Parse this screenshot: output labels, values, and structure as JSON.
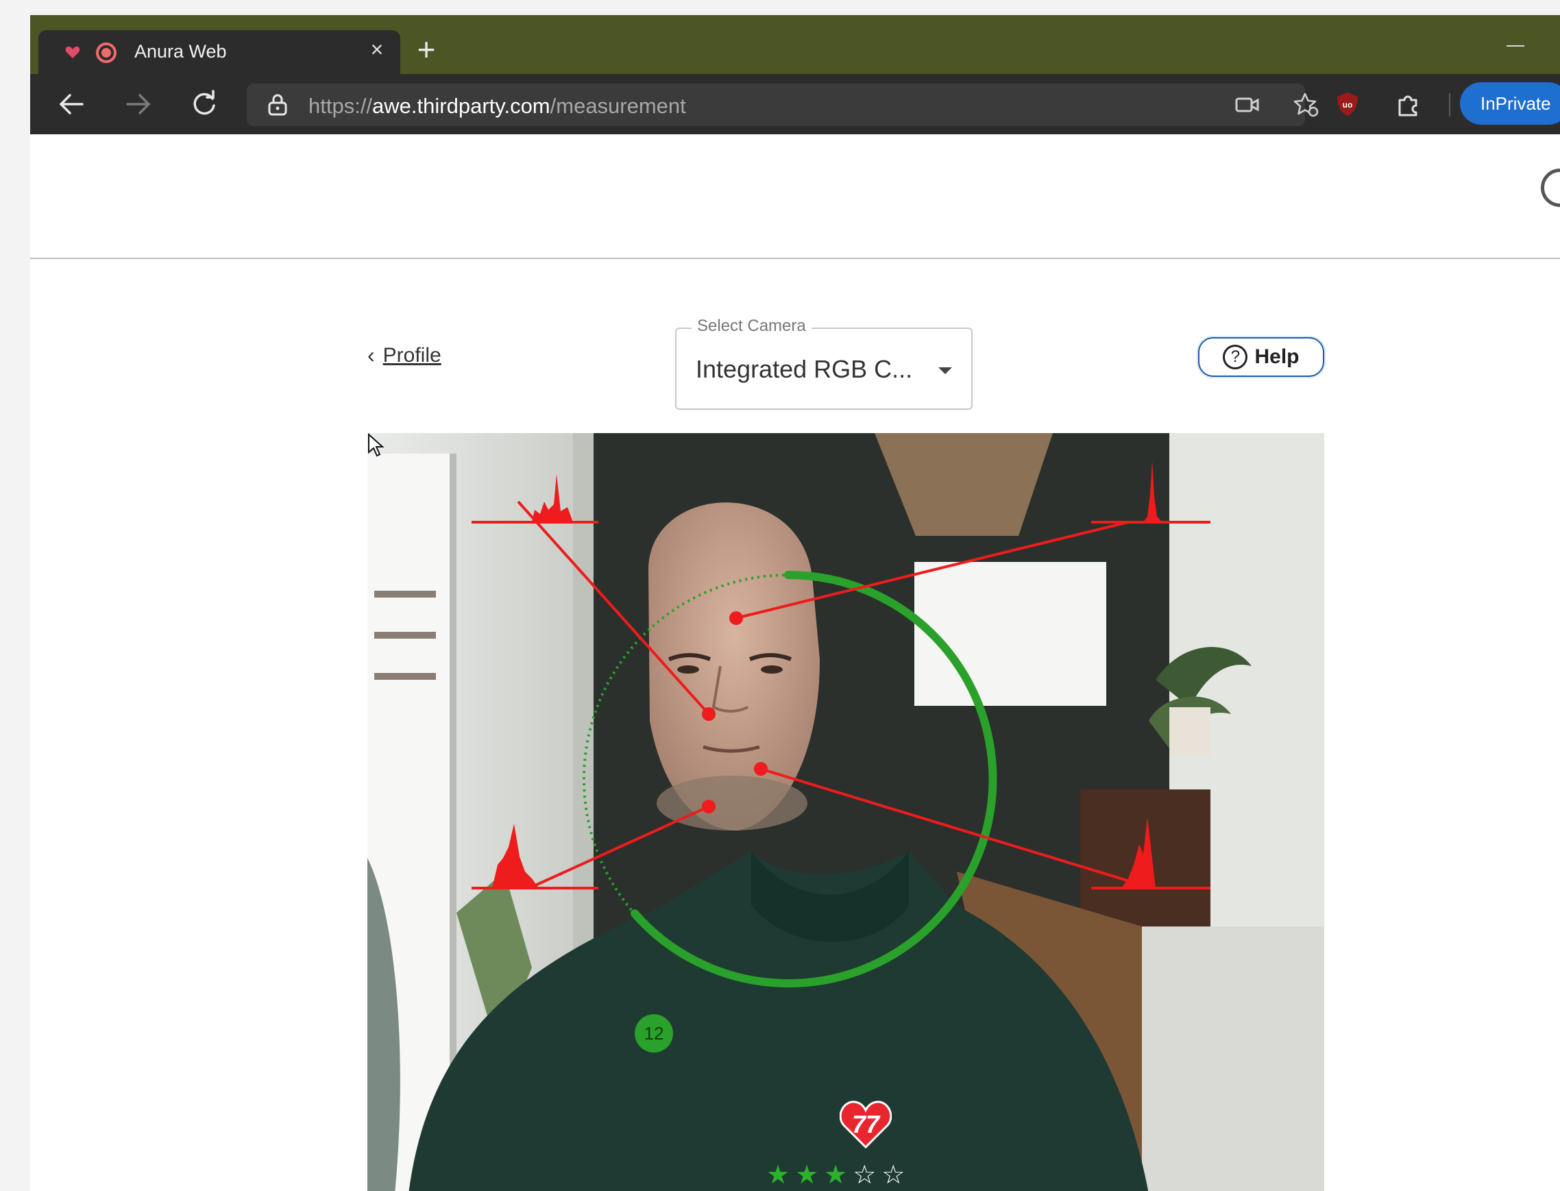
{
  "browser": {
    "tab": {
      "title": "Anura Web",
      "favicon": "record-icon",
      "close_label": "×"
    },
    "new_tab_label": "+",
    "url": {
      "scheme": "https://",
      "host": "awe.thirdparty.com",
      "path": "/measurement"
    },
    "inprivate_label": "InPrivate",
    "toolbar_icons": [
      "back-icon",
      "forward-icon",
      "reload-icon",
      "lock-icon",
      "camera-icon",
      "favorites-icon",
      "ublock-icon",
      "extensions-icon"
    ]
  },
  "page": {
    "back_link": {
      "chevron": "‹",
      "label": "Profile"
    },
    "camera_select": {
      "label": "Select Camera",
      "value": "Integrated RGB C..."
    },
    "help_button": {
      "icon": "?",
      "label": "Help"
    },
    "measurement": {
      "heart_rate": "77",
      "progress_count": "12",
      "stars_filled": 3,
      "stars_total": 5,
      "star_filled_glyph": "★★★",
      "star_empty_glyph": "☆☆",
      "colors": {
        "ring": "#2aa12a",
        "signal": "#ee1c1c"
      }
    }
  }
}
